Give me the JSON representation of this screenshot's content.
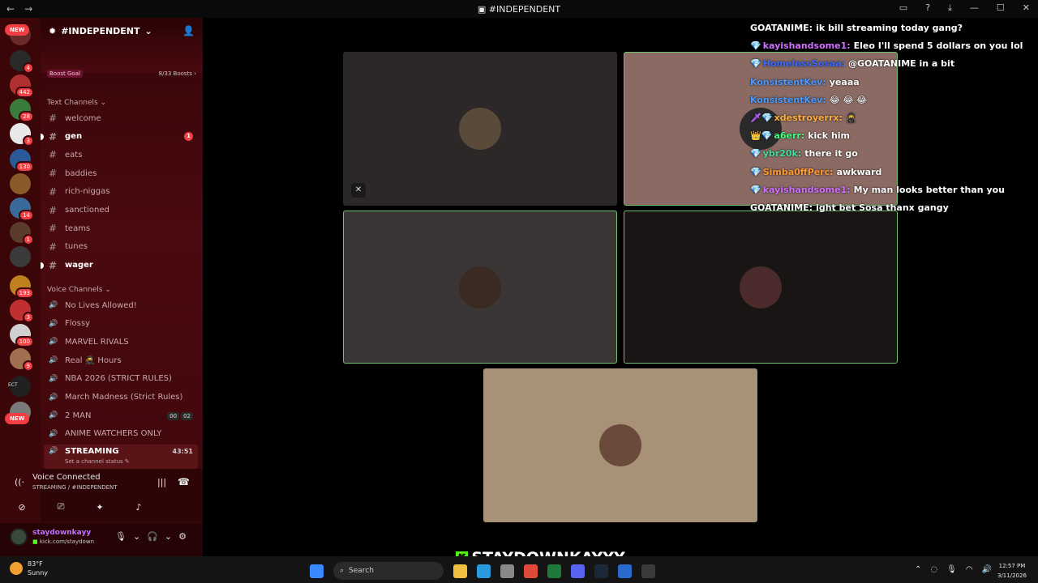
{
  "window": {
    "title": "#INDEPENDENT",
    "back_icon": "arrow-left-icon",
    "forward_icon": "arrow-right-icon"
  },
  "servers": [
    {
      "badge": "NEW",
      "color": "#6b2a2a"
    },
    {
      "badge": "4",
      "color": "#2a2a2a"
    },
    {
      "badge": "442",
      "color": "#b03030"
    },
    {
      "badge": "28",
      "color": "#3a7a3a"
    },
    {
      "badge": "3",
      "color": "#e8e8e8"
    },
    {
      "badge": "130",
      "color": "#2a5a9a"
    },
    {
      "badge": "",
      "color": "#8a5a2a"
    },
    {
      "badge": "14",
      "color": "#3a6a9a"
    },
    {
      "badge": "1",
      "color": "#5a3a2a"
    },
    {
      "badge": "",
      "color": "#3a3a3a"
    },
    {
      "badge": "193",
      "color": "#c08020"
    },
    {
      "badge": "3",
      "color": "#c03030"
    },
    {
      "badge": "100",
      "color": "#d0d0d0"
    },
    {
      "badge": "9",
      "color": "#a07050"
    },
    {
      "badge": "",
      "color": "#202020",
      "label": "ECT"
    },
    {
      "badge": "NEW",
      "color": "#7a7a7a"
    }
  ],
  "guild": {
    "name": "#INDEPENDENT",
    "boost_goal": "Boost Goal",
    "boosts": "8/33 Boosts",
    "text_category": "Text Channels",
    "voice_category": "Voice Channels"
  },
  "text_channels": [
    {
      "name": "welcome",
      "bold": false,
      "unread": ""
    },
    {
      "name": "gen",
      "bold": true,
      "unread": "1"
    },
    {
      "name": "eats",
      "bold": false,
      "unread": ""
    },
    {
      "name": "baddies",
      "bold": false,
      "unread": ""
    },
    {
      "name": "rich-niggas",
      "bold": false,
      "unread": ""
    },
    {
      "name": "sanctioned",
      "bold": false,
      "unread": ""
    },
    {
      "name": "teams",
      "bold": false,
      "unread": ""
    },
    {
      "name": "tunes",
      "bold": false,
      "unread": ""
    },
    {
      "name": "wager",
      "bold": true,
      "unread": ""
    }
  ],
  "voice_channels": [
    {
      "name": "No Lives Allowed!"
    },
    {
      "name": "Flossy"
    },
    {
      "name": "MARVEL RIVALS"
    },
    {
      "name": "Real 🥷 Hours"
    },
    {
      "name": "NBA 2026 (STRICT RULES)"
    },
    {
      "name": "March Madness (Strict Rules)"
    },
    {
      "name": "2 MAN",
      "count_a": "00",
      "count_b": "02"
    },
    {
      "name": "ANIME WATCHERS ONLY"
    },
    {
      "name": "STREAMING",
      "time": "43:51",
      "status": "Set a channel status"
    }
  ],
  "voice_connection": {
    "title": "Voice Connected",
    "subtitle": "STREAMING / #INDEPENDENT"
  },
  "user": {
    "name": "staydownkayy",
    "status": "kick.com/staydown"
  },
  "video_tiles": [
    {
      "bg": "#2b2827",
      "border": "none",
      "avatar": "#5a4a3a",
      "muted": true
    },
    {
      "bg": "#8a6a63",
      "border": "#6fbf6f",
      "avatar": "#2a2a2a"
    },
    {
      "bg": "#3a3636",
      "border": "#6fbf6f",
      "avatar": "#3a2a22"
    },
    {
      "bg": "#1a1515",
      "border": "#6fbf6f",
      "avatar": "#4a2a2a"
    },
    {
      "bg": "#a89277",
      "border": "none",
      "avatar": "#6a4a3a"
    }
  ],
  "chat": [
    {
      "badge": "",
      "user": "GOATANIME:",
      "color": "#ffffff",
      "text": "ik bill streaming today gang?"
    },
    {
      "badge": "💎",
      "user": "kayishandsome1:",
      "color": "#d070ff",
      "text": "Eleo I'll spend 5 dollars on you lol"
    },
    {
      "badge": "💎",
      "user": "HomelessSosaa:",
      "color": "#3a6aff",
      "text": "@GOATANIME in a bit"
    },
    {
      "badge": "",
      "user": "KonsistentKev:",
      "color": "#4a9aff",
      "text": "yeaaa"
    },
    {
      "badge": "",
      "user": "KonsistentKev:",
      "color": "#4a9aff",
      "text": "😂 😂 😂"
    },
    {
      "badge": "🗡💎",
      "user": "xdestroyerrx:",
      "color": "#ffb040",
      "text": "🥷"
    },
    {
      "badge": "👑💎",
      "user": "a6err:",
      "color": "#40ff80",
      "text": "kick him"
    },
    {
      "badge": "💎",
      "user": "ybr20k:",
      "color": "#40e0a0",
      "text": "there it go"
    },
    {
      "badge": "💎",
      "user": "Simba0ffPerc:",
      "color": "#ff9a30",
      "text": "awkward"
    },
    {
      "badge": "💎",
      "user": "kayishandsome1:",
      "color": "#d070ff",
      "text": "My man looks better than you"
    },
    {
      "badge": "",
      "user": "GOATANIME:",
      "color": "#ffffff",
      "text": "ight bet Sosa thanx gangy"
    }
  ],
  "watermark": {
    "logo": "K",
    "text": "STAYDOWNKAYYY"
  },
  "taskbar": {
    "weather_temp": "83°F",
    "weather_desc": "Sunny",
    "search": "Search",
    "time": "12:57 PM",
    "date": "3/11/2026",
    "apps": [
      {
        "name": "start-icon",
        "color": "#3a8aff"
      },
      {
        "name": "file-explorer-icon",
        "color": "#f0c040"
      },
      {
        "name": "edge-icon",
        "color": "#2a9adf"
      },
      {
        "name": "settings-icon",
        "color": "#888888"
      },
      {
        "name": "chrome-icon",
        "color": "#e04a3a"
      },
      {
        "name": "excel-icon",
        "color": "#1f7a3a"
      },
      {
        "name": "discord-icon",
        "color": "#5865f2"
      },
      {
        "name": "steam-icon",
        "color": "#1b2838"
      },
      {
        "name": "app-icon",
        "color": "#2a6acf"
      },
      {
        "name": "obs-icon",
        "color": "#3a3a3a"
      }
    ]
  }
}
